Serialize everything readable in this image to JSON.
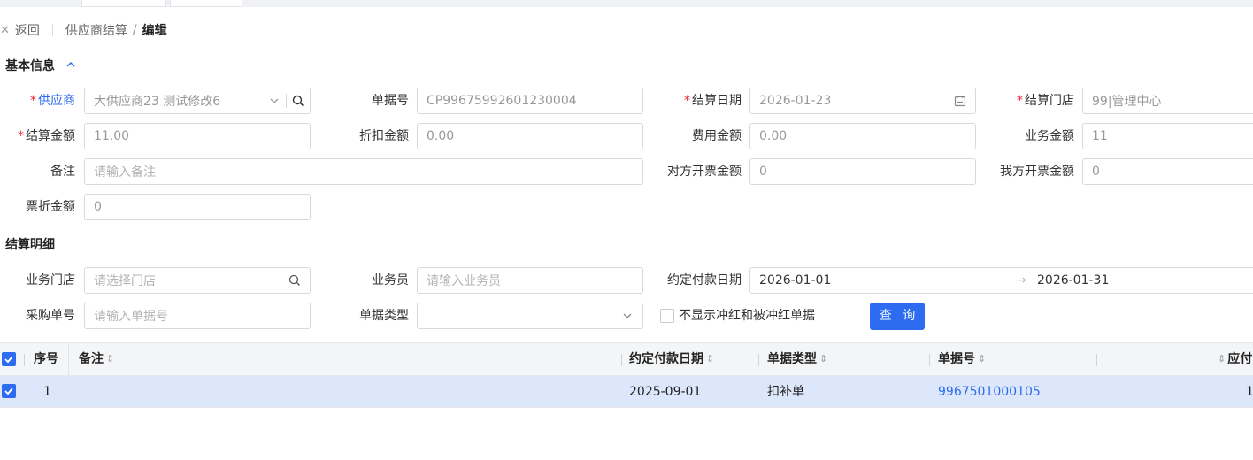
{
  "breadcrumb": {
    "back_label": "返回",
    "parent": "供应商结算",
    "current": "编辑"
  },
  "basic_section": {
    "title": "基本信息",
    "fields": {
      "supplier": {
        "label": "供应商",
        "value": "大供应商23 测试修改6"
      },
      "doc_no": {
        "label": "单据号",
        "value": "CP99675992601230004"
      },
      "settle_date": {
        "label": "结算日期",
        "value": "2026-01-23"
      },
      "settle_store": {
        "label": "结算门店",
        "value": "99|管理中心"
      },
      "settle_amount": {
        "label": "结算金额",
        "value": "11.00"
      },
      "discount_amount": {
        "label": "折扣金额",
        "value": "0.00"
      },
      "fee_amount": {
        "label": "费用金额",
        "value": "0.00"
      },
      "business_amount": {
        "label": "业务金额",
        "value": "11"
      },
      "remark": {
        "label": "备注",
        "placeholder": "请输入备注"
      },
      "other_invoice_amount": {
        "label": "对方开票金额",
        "value": "0"
      },
      "our_invoice_amount": {
        "label": "我方开票金额",
        "value": "0"
      },
      "ticket_discount": {
        "label": "票折金额",
        "value": "0"
      }
    }
  },
  "detail_section": {
    "title": "结算明细",
    "filters": {
      "store": {
        "label": "业务门店",
        "placeholder": "请选择门店"
      },
      "salesman": {
        "label": "业务员",
        "placeholder": "请输入业务员"
      },
      "pay_date": {
        "label": "约定付款日期",
        "start": "2026-01-01",
        "end": "2026-01-31"
      },
      "purchase_no": {
        "label": "采购单号",
        "placeholder": "请输入单据号"
      },
      "doc_type": {
        "label": "单据类型",
        "value": ""
      },
      "hide_red": {
        "label": "不显示冲红和被冲红单据"
      },
      "query_button": "查 询"
    }
  },
  "table": {
    "columns": {
      "seq": "序号",
      "remark": "备注",
      "pay_date": "约定付款日期",
      "doc_type": "单据类型",
      "doc_no": "单据号",
      "payable": "应付"
    },
    "rows": [
      {
        "seq": "1",
        "remark": "",
        "pay_date": "2025-09-01",
        "doc_type": "扣补单",
        "doc_no": "9967501000105",
        "payable": "1"
      }
    ]
  },
  "colors": {
    "accent": "#2d6cf0",
    "required": "#f5222d",
    "row_selected": "#dde7fb"
  }
}
